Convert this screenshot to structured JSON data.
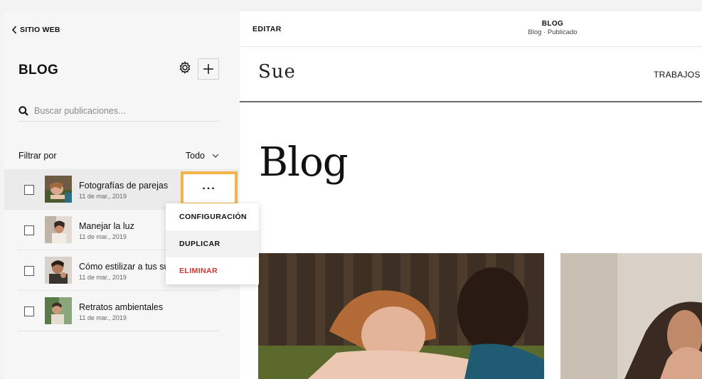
{
  "left_panel": {
    "back_label": "SITIO WEB",
    "title": "BLOG",
    "search_placeholder": "Buscar publicaciones...",
    "filter_label": "Filtrar por",
    "filter_value": "Todo",
    "posts": [
      {
        "title": "Fotografías de parejas",
        "date": "11 de mar., 2019"
      },
      {
        "title": "Manejar la luz",
        "date": "11 de mar., 2019"
      },
      {
        "title": "Cómo estilizar a tus su",
        "date": "11 de mar., 2019"
      },
      {
        "title": "Retratos ambientales",
        "date": "11 de mar., 2019"
      }
    ],
    "more_label": "...",
    "context_menu": {
      "settings": "CONFIGURACIÓN",
      "duplicate": "DUPLICAR",
      "delete": "ELIMINAR"
    }
  },
  "editor": {
    "edit_label": "EDITAR",
    "page_title": "BLOG",
    "page_status": "Blog · Publicado"
  },
  "site": {
    "logo": "Sue",
    "nav_item": "TRABAJOS",
    "heading": "Blog"
  },
  "colors": {
    "highlight": "#f2b44b",
    "danger": "#d0342c"
  }
}
